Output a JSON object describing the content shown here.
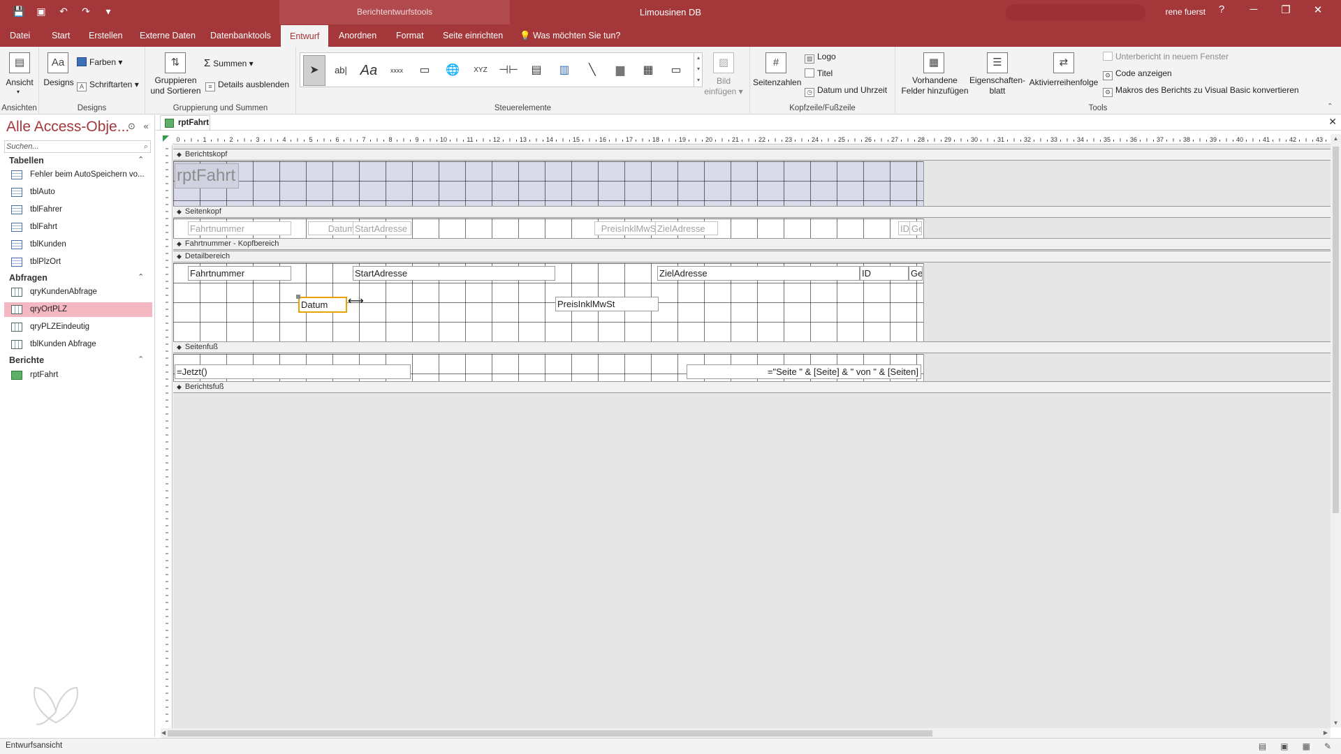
{
  "titlebar": {
    "tools_title": "Berichtentwurfstools",
    "app_title": "Limousinen DB",
    "user": "rene fuerst",
    "help": "?",
    "min": "─",
    "restore": "❐",
    "close": "✕",
    "qat": [
      "💾",
      "▣",
      "↶",
      "↷",
      "▾"
    ]
  },
  "tabs": [
    "Datei",
    "Start",
    "Erstellen",
    "Externe Daten",
    "Datenbanktools",
    "Entwurf",
    "Anordnen",
    "Format",
    "Seite einrichten"
  ],
  "tell_me": "Was möchten Sie tun?",
  "ribbon": {
    "ansicht": "Ansicht",
    "designs": "Designs",
    "farben": "Farben",
    "schriftarten": "Schriftarten",
    "gruppieren": "Gruppieren",
    "und_sortieren": "und Sortieren",
    "summen": "Summen",
    "details_ausblenden": "Details ausblenden",
    "bild": "Bild",
    "einfuegen": "einfügen",
    "seitenzahlen": "Seitenzahlen",
    "logo": "Logo",
    "titel": "Titel",
    "datum_uhrzeit": "Datum und Uhrzeit",
    "vorhandene": "Vorhandene",
    "felder_hinzufuegen": "Felder hinzufügen",
    "eigenschaften": "Eigenschaften-",
    "blatt": "blatt",
    "aktivierreihenfolge": "Aktivierreihenfolge",
    "unterbericht": "Unterbericht in neuem Fenster",
    "code_anzeigen": "Code anzeigen",
    "makros": "Makros des Berichts zu Visual Basic konvertieren",
    "groups": {
      "ansichten": "Ansichten",
      "designs": "Designs",
      "gruppierung": "Gruppierung und Summen",
      "steuerelemente": "Steuerelemente",
      "kopfzeile": "Kopfzeile/Fußzeile",
      "tools": "Tools"
    },
    "controls": [
      "➤",
      "ab|",
      "Aa",
      "xxxx",
      "▭",
      "🌐",
      "XYZ",
      "⊣⊢",
      "▤",
      "▥",
      "╲",
      "▆",
      "▦",
      "▭"
    ]
  },
  "nav": {
    "title": "Alle Access-Obje...",
    "search_placeholder": "Suchen...",
    "groups": [
      {
        "label": "Tabellen",
        "items": [
          "Fehler beim AutoSpeichern vo...",
          "tblAuto",
          "tblFahrer",
          "tblFahrt",
          "tblKunden",
          "tblPlzOrt"
        ]
      },
      {
        "label": "Abfragen",
        "items": [
          "qryKundenAbfrage",
          "qryOrtPLZ",
          "qryPLZEindeutig",
          "tblKunden Abfrage"
        ]
      },
      {
        "label": "Berichte",
        "items": [
          "rptFahrt"
        ]
      }
    ]
  },
  "doc": {
    "tab": "rptFahrt",
    "sections": {
      "berichtskopf": "Berichtskopf",
      "seitenkopf": "Seitenkopf",
      "gruppenkopf": "Fahrtnummer - Kopfbereich",
      "detail": "Detailbereich",
      "seitenfuss": "Seitenfuß",
      "berichtsfuss": "Berichtsfuß"
    },
    "report_title": "rptFahrt",
    "header_labels": {
      "fahrtnummer": "Fahrtnummer",
      "datum": "Datum",
      "startadresse": "StartAdresse",
      "preis": "PreisInklMwSt",
      "zieladresse": "ZielAdresse",
      "id": "ID",
      "ge": "Ge"
    },
    "detail_fields": {
      "fahrtnummer": "Fahrtnummer",
      "startadresse": "StartAdresse",
      "zieladresse": "ZielAdresse",
      "id": "ID",
      "ge": "Ge",
      "datum": "Datum",
      "preis": "PreisInklMwSt"
    },
    "footer": {
      "jetzt": "=Jetzt()",
      "seite": "=\"Seite \" & [Seite] & \" von \" & [Seiten]"
    }
  },
  "status": {
    "text": "Entwurfsansicht"
  }
}
